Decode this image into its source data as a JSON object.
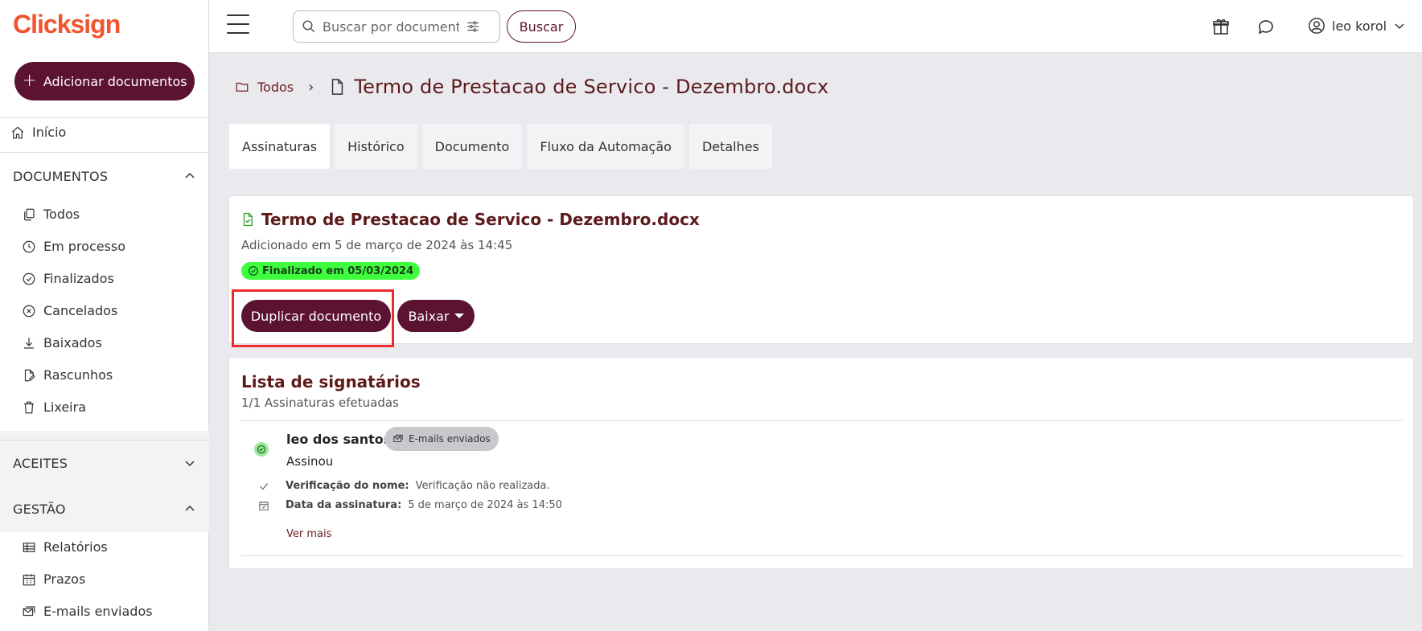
{
  "app": {
    "logo": "Clicksign"
  },
  "sidebar": {
    "add_label": "Adicionar documentos",
    "home_label": "Início",
    "sections": {
      "documentos": "DOCUMENTOS",
      "aceites": "ACEITES",
      "gestao": "GESTÃO"
    },
    "documentos_items": [
      {
        "label": "Todos",
        "icon": "copy-icon"
      },
      {
        "label": "Em processo",
        "icon": "clock-icon"
      },
      {
        "label": "Finalizados",
        "icon": "check-circle-icon"
      },
      {
        "label": "Cancelados",
        "icon": "x-circle-icon"
      },
      {
        "label": "Baixados",
        "icon": "download-icon"
      },
      {
        "label": "Rascunhos",
        "icon": "draft-icon"
      },
      {
        "label": "Lixeira",
        "icon": "trash-icon"
      }
    ],
    "gestao_items": [
      {
        "label": "Relatórios",
        "icon": "table-icon"
      },
      {
        "label": "Prazos",
        "icon": "calendar-icon"
      },
      {
        "label": "E-mails enviados",
        "icon": "mail-icon"
      }
    ]
  },
  "header": {
    "search_placeholder": "Buscar por documento",
    "search_button": "Buscar",
    "user_name": "leo korol"
  },
  "breadcrumb": {
    "root": "Todos",
    "title": "Termo de Prestacao de Servico - Dezembro.docx"
  },
  "tabs": [
    "Assinaturas",
    "Histórico",
    "Documento",
    "Fluxo da Automação",
    "Detalhes"
  ],
  "document": {
    "title": "Termo de Prestacao de Servico - Dezembro.docx",
    "added": "Adicionado em 5 de março de 2024 às 14:45",
    "status": "Finalizado em 05/03/2024",
    "duplicate_label": "Duplicar documento",
    "download_label": "Baixar"
  },
  "signers": {
    "title": "Lista de signatários",
    "subtitle": "1/1 Assinaturas efetuadas",
    "items": [
      {
        "name": "leo dos santos",
        "badge": "E-mails enviados",
        "status": "Assinou",
        "name_check_label": "Verificação do nome:",
        "name_check_value": "Verificação não realizada.",
        "date_label": "Data da assinatura:",
        "date_value": "5 de março de 2024 às 14:50",
        "more": "Ver mais"
      }
    ]
  },
  "colors": {
    "brand": "#5c1231",
    "logo": "#f2542d",
    "status_green": "#3dff3d",
    "highlight": "#ee2a2a"
  }
}
